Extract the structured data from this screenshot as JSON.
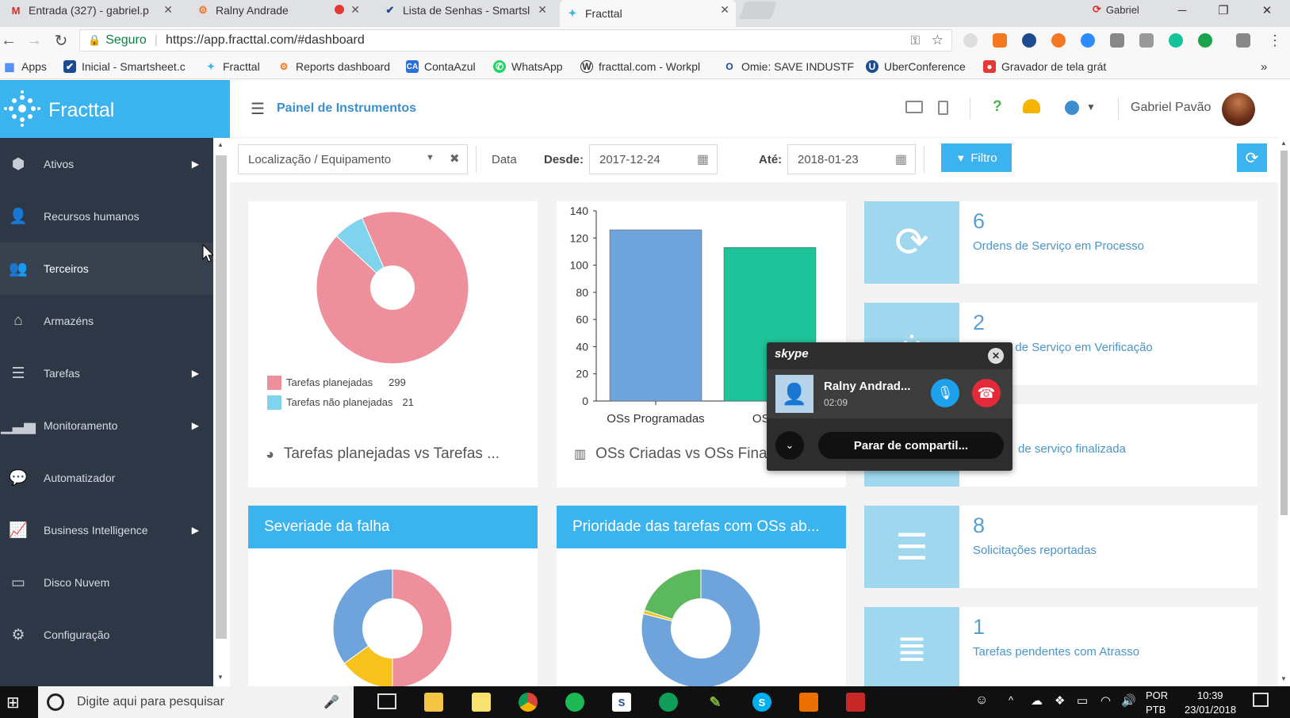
{
  "browser": {
    "tabs": [
      {
        "label": "Entrada (327) - gabriel.p",
        "icon": "gmail-icon"
      },
      {
        "label": "Ralny Andrade",
        "icon": "hubspot-icon"
      },
      {
        "label": "Lista de Senhas - Smartsl",
        "icon": "smartsheet-icon"
      },
      {
        "label": "Fracttal",
        "icon": "fracttal-icon"
      }
    ],
    "profile": "Gabriel",
    "secure_label": "Seguro",
    "url": "https://app.fracttal.com/#dashboard",
    "bookmarks": [
      {
        "label": "Apps"
      },
      {
        "label": "Inicial - Smartsheet.c"
      },
      {
        "label": "Fracttal"
      },
      {
        "label": "Reports dashboard"
      },
      {
        "label": "ContaAzul"
      },
      {
        "label": "WhatsApp"
      },
      {
        "label": "fracttal.com - Workpl"
      },
      {
        "label": "Omie: SAVE INDUSTF"
      },
      {
        "label": "UberConference"
      },
      {
        "label": "Gravador de tela grát"
      }
    ]
  },
  "app": {
    "brand": "Fracttal",
    "page_title": "Painel de Instrumentos",
    "user_name": "Gabriel Pavão",
    "sidebar": [
      {
        "label": "Ativos",
        "icon": "cubes-icon",
        "arrow": true
      },
      {
        "label": "Recursos humanos",
        "icon": "user-icon",
        "arrow": false
      },
      {
        "label": "Terceiros",
        "icon": "users-icon",
        "arrow": false
      },
      {
        "label": "Armazéns",
        "icon": "inbox-icon",
        "arrow": false
      },
      {
        "label": "Tarefas",
        "icon": "tasks-icon",
        "arrow": true
      },
      {
        "label": "Monitoramento",
        "icon": "signal-icon",
        "arrow": true
      },
      {
        "label": "Automatizador",
        "icon": "chat-bubble-icon",
        "arrow": false
      },
      {
        "label": "Business Intelligence",
        "icon": "line-chart-icon",
        "arrow": true
      },
      {
        "label": "Disco Nuvem",
        "icon": "hdd-icon",
        "arrow": false
      },
      {
        "label": "Configuração",
        "icon": "gear-icon",
        "arrow": false
      }
    ],
    "filters": {
      "location_placeholder": "Localização / Equipamento",
      "data_label": "Data",
      "desde_label": "Desde:",
      "desde_value": "2017-12-24",
      "ate_label": "Até:",
      "ate_value": "2018-01-23",
      "filter_button": "Filtro"
    },
    "pie_card": {
      "title": "Tarefas planejadas vs Tarefas ...",
      "legend": [
        {
          "label": "Tarefas planejadas",
          "value": "299",
          "color": "#ee8f9c"
        },
        {
          "label": "Tarefas não planejadas",
          "value": "21",
          "color": "#7fd3ec"
        }
      ]
    },
    "bar_card": {
      "title": "OSs Criadas vs OSs Finalizadas"
    },
    "kpis": [
      {
        "number": "6",
        "label": "Ordens de Serviço em Processo",
        "icon": "refresh-icon"
      },
      {
        "number": "2",
        "label": "Ordens de Serviço em Verificação",
        "icon": "spinner-icon"
      },
      {
        "number": "",
        "label": "de serviço finalizada",
        "icon": "check-icon"
      },
      {
        "number": "8",
        "label": "Solicitações reportadas",
        "icon": "list-icon"
      },
      {
        "number": "1",
        "label": "Tarefas pendentes com Atrasso",
        "icon": "server-icon"
      }
    ],
    "severity_card": {
      "title": "Severiade da falha"
    },
    "priority_card": {
      "title": "Prioridade das tarefas com OSs ab..."
    }
  },
  "chart_data": [
    {
      "type": "pie",
      "categories": [
        "Tarefas planejadas",
        "Tarefas não planejadas"
      ],
      "values": [
        299,
        21
      ],
      "colors": [
        "#ee8f9c",
        "#7fd3ec"
      ],
      "title": "Tarefas planejadas vs Tarefas ..."
    },
    {
      "type": "bar",
      "categories": [
        "OSs Programadas",
        "OSs C"
      ],
      "values": [
        126,
        113
      ],
      "colors": [
        "#6fa3dc",
        "#1fc39a"
      ],
      "ylim": [
        0,
        140
      ],
      "yticks": [
        0,
        20,
        40,
        60,
        80,
        100,
        120,
        140
      ],
      "title": "OSs Criadas vs OSs Finalizadas"
    },
    {
      "type": "pie",
      "values": [
        50,
        15,
        35
      ],
      "colors": [
        "#ee8f9c",
        "#f7c21c",
        "#6fa3dc"
      ],
      "title": "Severiade da falha"
    },
    {
      "type": "pie",
      "values": [
        79,
        1,
        20
      ],
      "colors": [
        "#6fa3dc",
        "#f7c21c",
        "#5cb85c"
      ],
      "title": "Prioridade das tarefas com OSs ab..."
    }
  ],
  "skype": {
    "brand": "skype",
    "caller": "Ralny Andrad...",
    "duration": "02:09",
    "share_button": "Parar de compartil..."
  },
  "taskbar": {
    "search_placeholder": "Digite aqui para pesquisar",
    "lang1": "POR",
    "lang2": "PTB",
    "time": "10:39",
    "date": "23/01/2018"
  }
}
